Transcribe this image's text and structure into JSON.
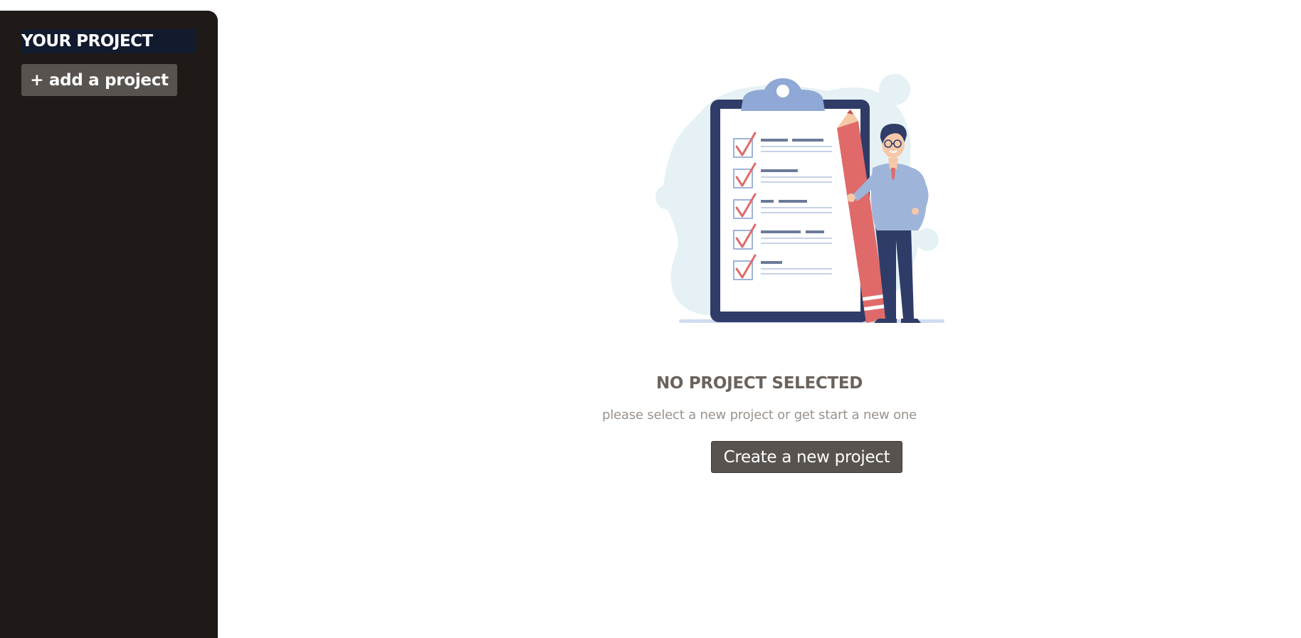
{
  "sidebar": {
    "title": "YOUR PROJECT",
    "add_button_label": "+ add a project"
  },
  "main": {
    "empty_state": {
      "illustration_icon": "clipboard-checklist-person-illustration",
      "title": "NO PROJECT SELECTED",
      "subtitle": "please select a new project or get start a new one",
      "create_button_label": "Create a new project"
    }
  },
  "colors": {
    "sidebar_bg": "#1f1a17",
    "title_bg": "#121a2e",
    "button_bg": "#58534f",
    "heading_text": "#6b625c",
    "subtitle_text": "#9a928c",
    "illustration_navy": "#2f3c68",
    "illustration_blue": "#8fa8d6",
    "illustration_red": "#e06a6a",
    "illustration_bg_blob": "#e5f1f4"
  }
}
